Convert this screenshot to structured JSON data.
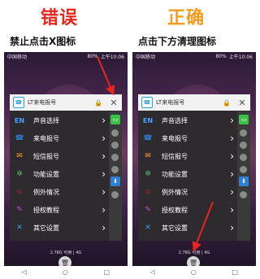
{
  "headings": {
    "wrong": "错误",
    "right": "正确",
    "caption_left": "禁止点击X图标",
    "caption_right": "点击下方清理图标"
  },
  "status_bar": {
    "carrier": "中国移动",
    "battery": "80%",
    "time": "上午10:06"
  },
  "card": {
    "app_name": "LT来电报号",
    "lock_icon": "lock-icon",
    "close_icon": "close-icon"
  },
  "menu": [
    {
      "label": "声音选择",
      "icon": "EN",
      "icon_color": "#4aa3ff"
    },
    {
      "label": "来电报号",
      "icon": "☎",
      "icon_color": "#2e7fd6"
    },
    {
      "label": "短信报号",
      "icon": "✉",
      "icon_color": "#f5a623"
    },
    {
      "label": "功能设置",
      "icon": "✲",
      "icon_color": "#5cc06a"
    },
    {
      "label": "例外情况",
      "icon": "⦸",
      "icon_color": "#e8251c"
    },
    {
      "label": "授权教程",
      "icon": "✎",
      "icon_color": "#b057d6"
    },
    {
      "label": "其它设置",
      "icon": "✕",
      "icon_color": "#3aa0e0"
    }
  ],
  "memory_text": "2.78G 可用 | 4G",
  "nav": {
    "back": "◁",
    "home": "○",
    "recent": "□"
  },
  "colors": {
    "wrong": "#e8251c",
    "right": "#f39b1a",
    "arrow": "#e8251c"
  }
}
